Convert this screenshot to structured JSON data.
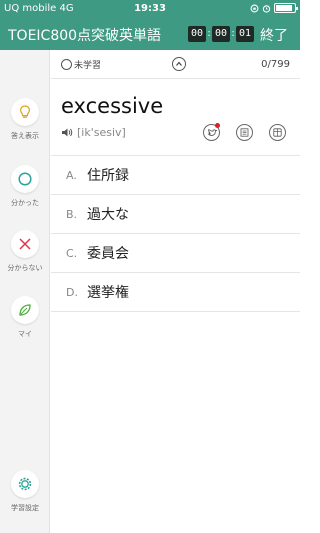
{
  "status_bar": {
    "carrier": "UQ mobile  4G",
    "time": "19:33",
    "battery_level": 0.9
  },
  "app_bar": {
    "title": "TOEIC800点突破英単語",
    "timer": [
      "00",
      "00",
      "01"
    ],
    "timer_separator": ":",
    "end_label": "終了"
  },
  "sidebar": {
    "items": [
      {
        "label": "答え表示",
        "icon": "lightbulb-icon"
      },
      {
        "label": "分かった",
        "icon": "circle-icon"
      },
      {
        "label": "分からない",
        "icon": "cross-icon"
      },
      {
        "label": "マイ",
        "icon": "leaf-icon"
      },
      {
        "label": "学習設定",
        "icon": "gear-icon"
      }
    ]
  },
  "progress": {
    "status": "未学習",
    "counter": "0/799"
  },
  "card": {
    "word": "excessive",
    "pronunciation": "[ik'sesiv]"
  },
  "choices": [
    {
      "letter": "A.",
      "text": "住所録"
    },
    {
      "letter": "B.",
      "text": "過大な"
    },
    {
      "letter": "C.",
      "text": "委員会"
    },
    {
      "letter": "D.",
      "text": "選挙権"
    }
  ],
  "colors": {
    "brand": "#3e9a83",
    "icon_orange": "#e0a020",
    "icon_teal": "#2aa39a",
    "icon_red": "#e0334a",
    "icon_green": "#4fae3c",
    "notify_red": "#e21b2c"
  }
}
